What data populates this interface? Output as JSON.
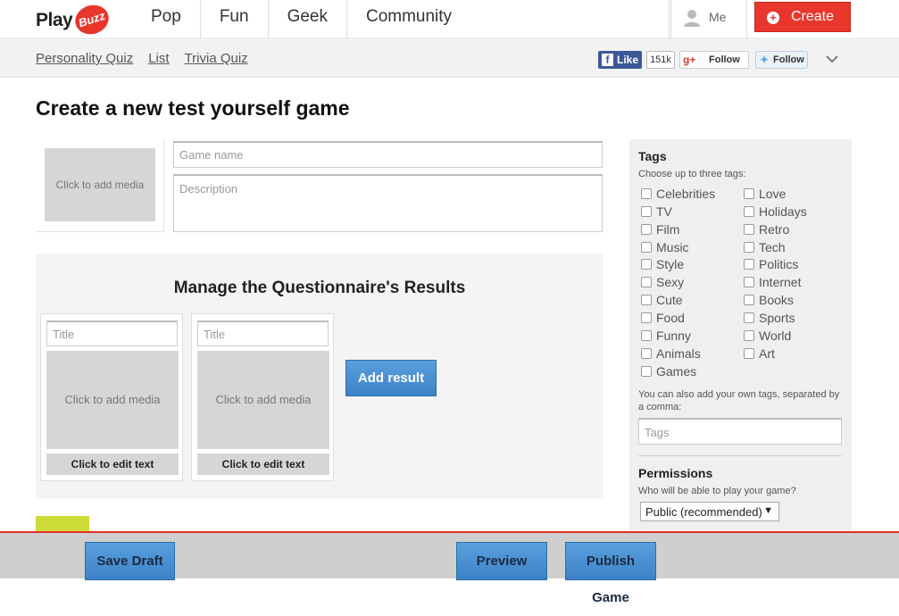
{
  "header": {
    "logo_play": "Play",
    "logo_buzz": "Buzz",
    "nav": [
      "Pop",
      "Fun",
      "Geek",
      "Community"
    ],
    "me_label": "Me",
    "create_label": "Create",
    "accent_color": "#e8362d"
  },
  "subbar": {
    "links": [
      "Personality Quiz",
      "List",
      "Trivia Quiz"
    ],
    "fb_like_label": "Like",
    "fb_count": "151k",
    "gplus_follow_label": "Follow",
    "twitter_follow_label": "Follow"
  },
  "page": {
    "title": "Create a new test yourself game"
  },
  "game_form": {
    "media_placeholder": "Click to add media",
    "name_placeholder": "Game name",
    "description_placeholder": "Description"
  },
  "results": {
    "title": "Manage the Questionnaire's Results",
    "cards": [
      {
        "title_placeholder": "Title",
        "media_placeholder": "Click to add media",
        "edit_text": "Click to edit text"
      },
      {
        "title_placeholder": "Title",
        "media_placeholder": "Click to add media",
        "edit_text": "Click to edit text"
      }
    ],
    "add_result_label": "Add result"
  },
  "sidebar": {
    "tags_heading": "Tags",
    "tags_hint": "Choose up to three tags:",
    "tags_col1": [
      "Celebrities",
      "TV",
      "Film",
      "Music",
      "Style",
      "Sexy",
      "Cute",
      "Food",
      "Funny",
      "Animals",
      "Games"
    ],
    "tags_col2": [
      "Love",
      "Holidays",
      "Retro",
      "Tech",
      "Politics",
      "Internet",
      "Books",
      "Sports",
      "World",
      "Art"
    ],
    "custom_tags_hint": "You can also add your own tags, separated by a comma:",
    "tags_input_placeholder": "Tags",
    "permissions_heading": "Permissions",
    "permissions_hint": "Who will be able to play your game?",
    "permissions_value": "Public (recommended)"
  },
  "bottombar": {
    "save_draft_label": "Save Draft",
    "preview_label": "Preview",
    "publish_label": "Publish Game"
  }
}
